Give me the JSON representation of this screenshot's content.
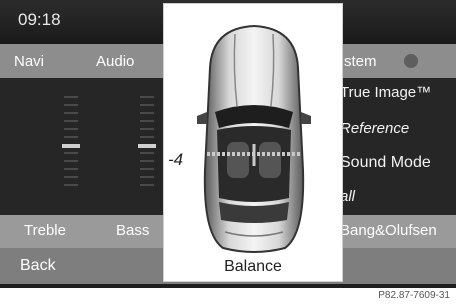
{
  "status": {
    "time": "09:18"
  },
  "nav": {
    "navi": "Navi",
    "audio": "Audio",
    "system": "stem"
  },
  "menu": {
    "true_image": "True Image™",
    "reference": "Reference",
    "sound_mode": "Sound Mode",
    "all": "all"
  },
  "tabs": {
    "treble": "Treble",
    "bass": "Bass",
    "bang": "Bang&Olufsen"
  },
  "back": "Back",
  "balance": {
    "value": "-4",
    "label": "Balance"
  },
  "reference_code": "P82.87-7609-31"
}
